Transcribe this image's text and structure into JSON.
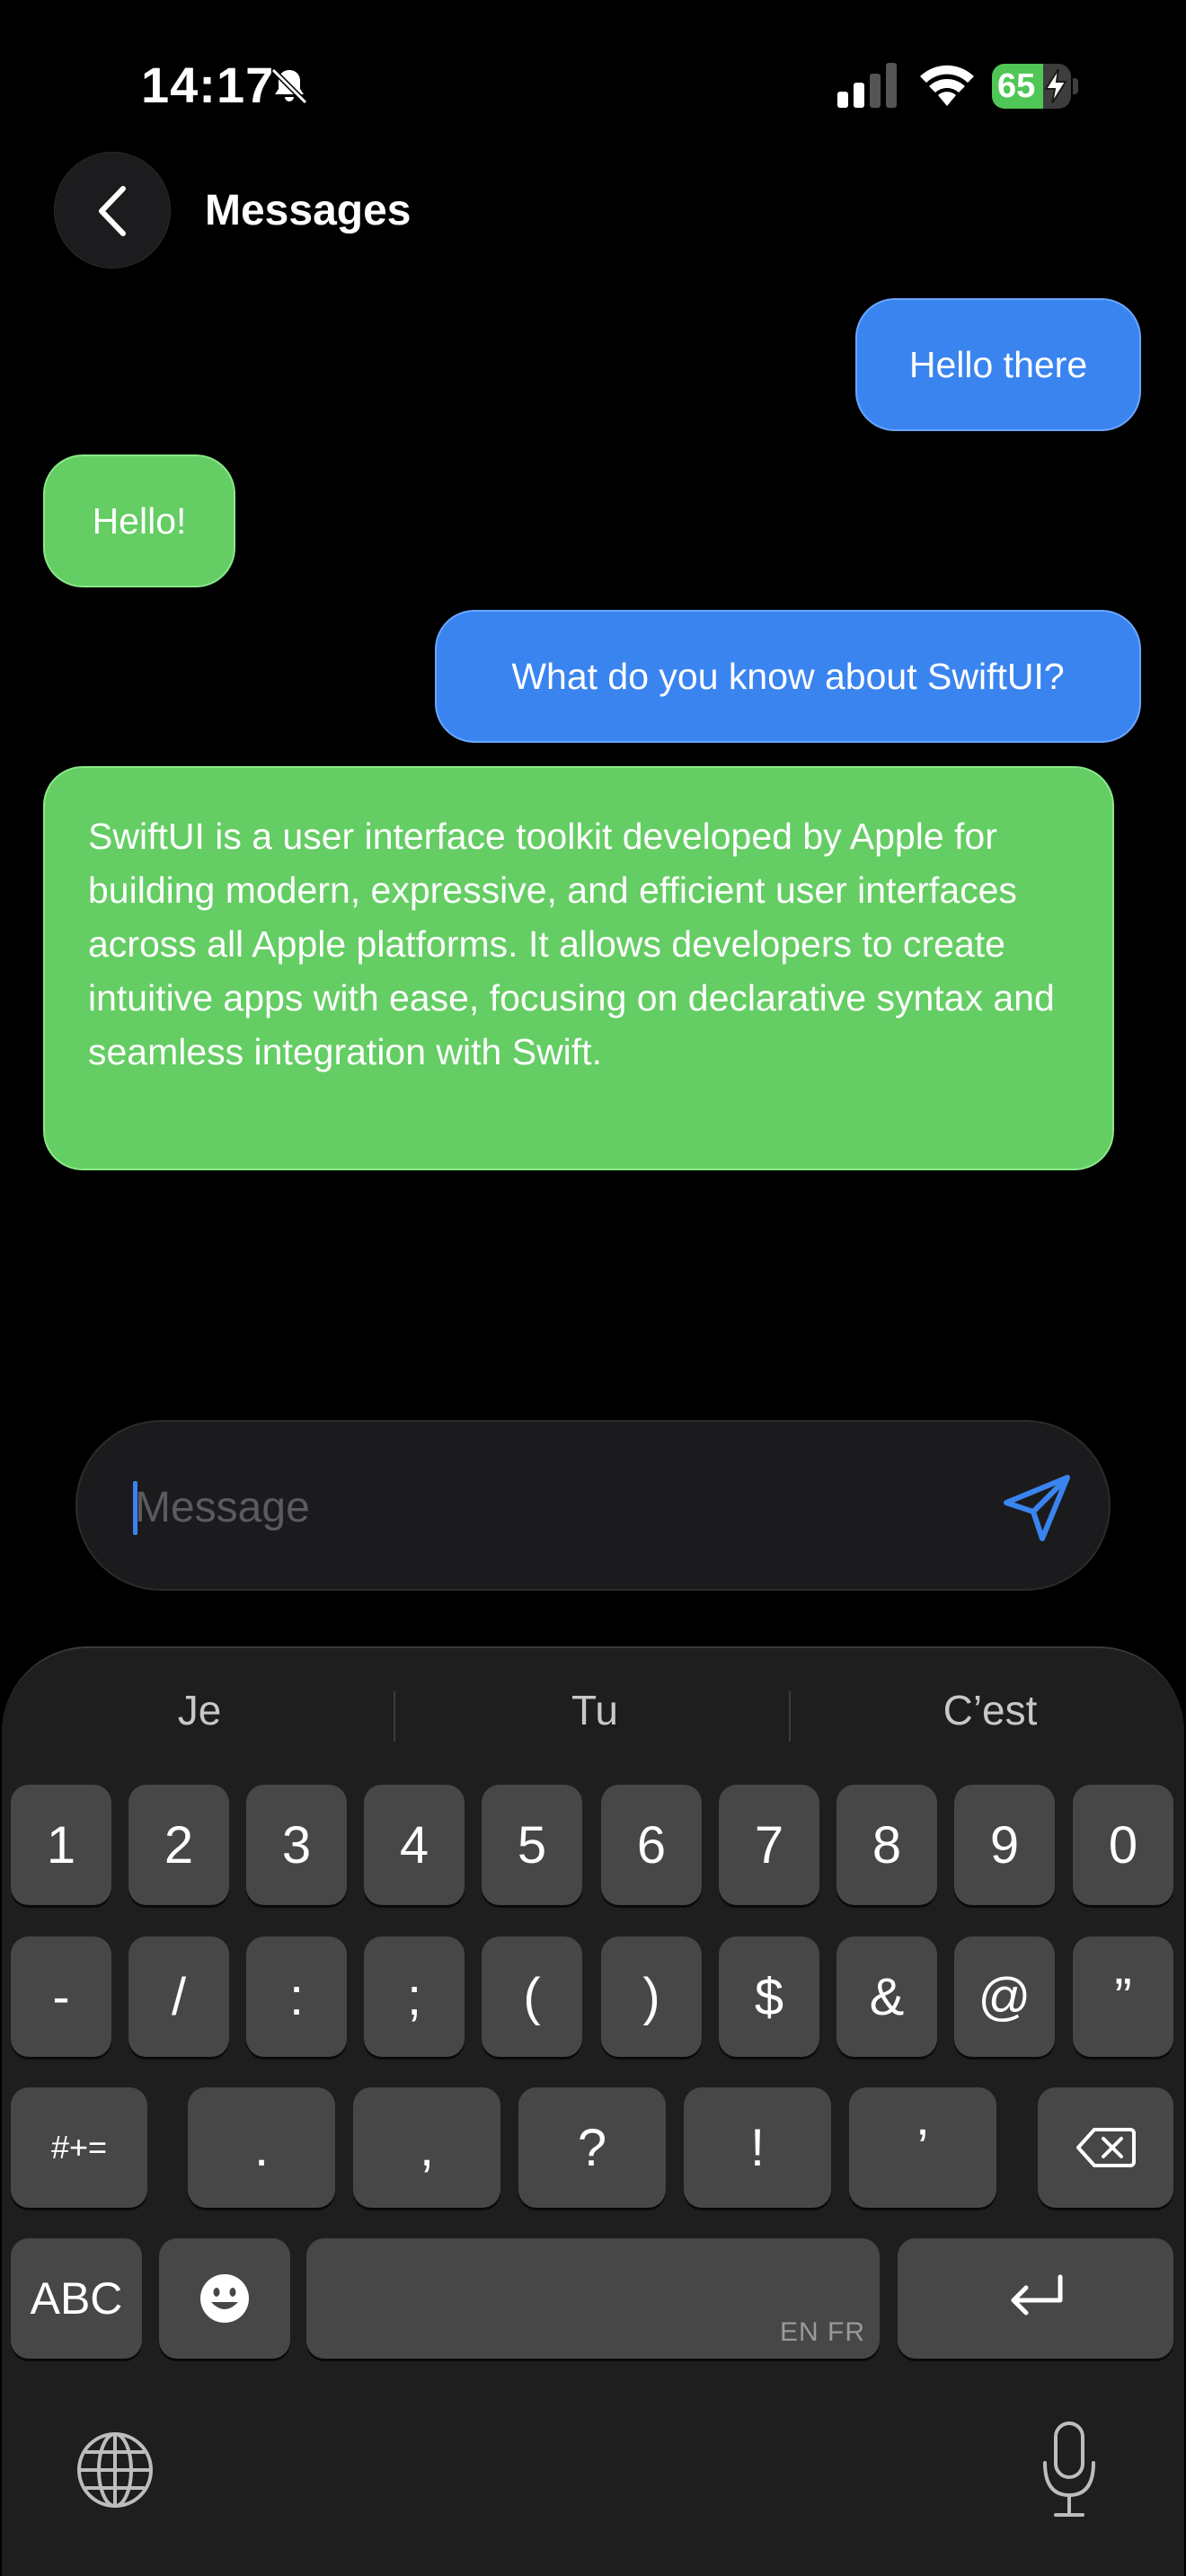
{
  "status": {
    "time": "14:17",
    "battery_level": "65",
    "battery_fraction": 0.65,
    "icons": [
      "bell-slash-icon",
      "cellular-signal-icon",
      "wifi-icon",
      "battery-charging-icon"
    ]
  },
  "nav": {
    "title": "Messages",
    "back_icon": "chevron-left-icon"
  },
  "messages": [
    {
      "role": "user",
      "text": "Hello there"
    },
    {
      "role": "assistant",
      "text": "Hello!"
    },
    {
      "role": "user",
      "text": "What do you know about SwiftUI?"
    },
    {
      "role": "assistant",
      "text": "SwiftUI is a user interface toolkit developed by Apple for building modern, expressive, and efficient user interfaces across all Apple platforms. It allows developers to create intuitive apps with ease, focusing on declarative syntax and seamless integration with Swift."
    }
  ],
  "input": {
    "placeholder": "Message",
    "value": "",
    "send_icon": "paper-plane-icon"
  },
  "keyboard": {
    "suggestions": [
      "Je",
      "Tu",
      "C’est"
    ],
    "row1": [
      "1",
      "2",
      "3",
      "4",
      "5",
      "6",
      "7",
      "8",
      "9",
      "0"
    ],
    "row2": [
      "-",
      "/",
      ":",
      ";",
      "(",
      ")",
      "$",
      "&",
      "@",
      "”"
    ],
    "row3": {
      "symbols_key": "#+=",
      "keys": [
        ".",
        ",",
        "?",
        "!",
        "’"
      ],
      "delete_icon": "delete-backward-icon"
    },
    "row4": {
      "abc_key": "ABC",
      "emoji_icon": "emoji-face-icon",
      "space_hint": "EN FR",
      "return_icon": "return-arrow-icon"
    },
    "bottom": {
      "globe_icon": "globe-icon",
      "mic_icon": "microphone-icon"
    }
  },
  "colors": {
    "user_bubble": "#3a84f0",
    "assistant_bubble": "#64cd63",
    "accent": "#3a84f0",
    "battery_fill": "#4fc656"
  }
}
